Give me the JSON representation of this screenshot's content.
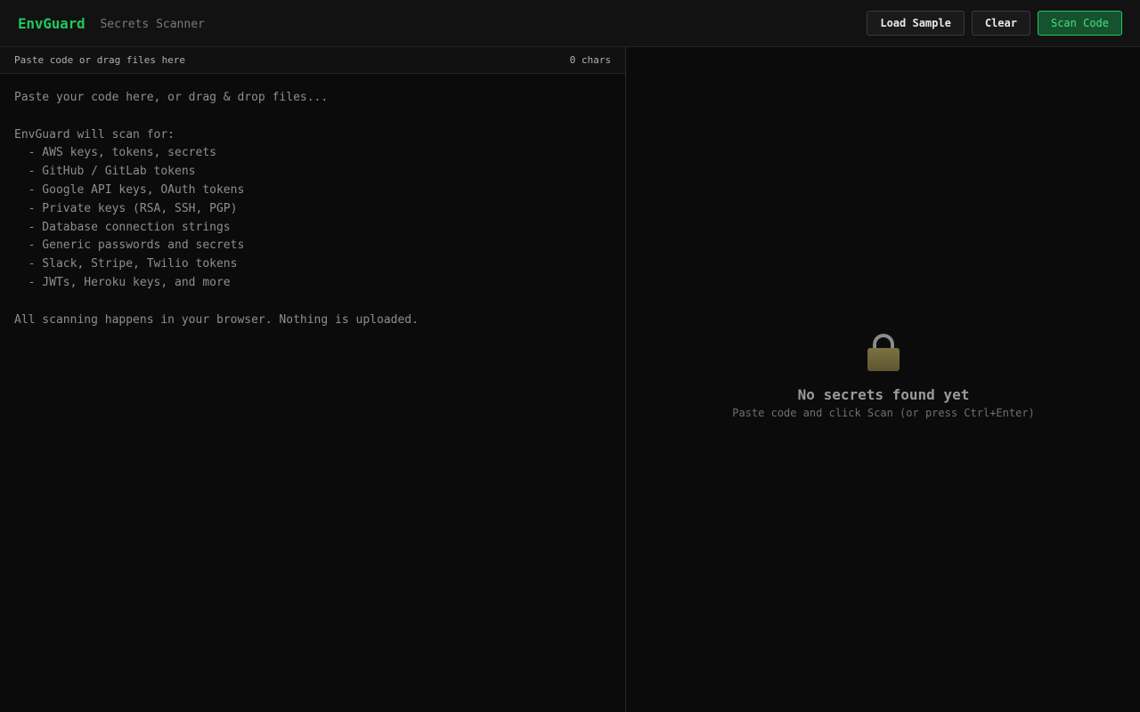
{
  "header": {
    "brand": "EnvGuard",
    "subtitle": "Secrets Scanner",
    "load_sample_label": "Load Sample",
    "clear_label": "Clear",
    "scan_label": "Scan Code"
  },
  "editor": {
    "bar_label": "Paste code or drag files here",
    "char_count": "0 chars",
    "placeholder": "Paste your code here, or drag & drop files...\n\nEnvGuard will scan for:\n  - AWS keys, tokens, secrets\n  - GitHub / GitLab tokens\n  - Google API keys, OAuth tokens\n  - Private keys (RSA, SSH, PGP)\n  - Database connection strings\n  - Generic passwords and secrets\n  - Slack, Stripe, Twilio tokens\n  - JWTs, Heroku keys, and more\n\nAll scanning happens in your browser. Nothing is uploaded."
  },
  "results": {
    "icon": "lock-icon",
    "empty_title": "No secrets found yet",
    "empty_hint": "Paste code and click Scan (or press Ctrl+Enter)"
  },
  "colors": {
    "accent": "#22c55e",
    "background": "#0b0b0b"
  }
}
